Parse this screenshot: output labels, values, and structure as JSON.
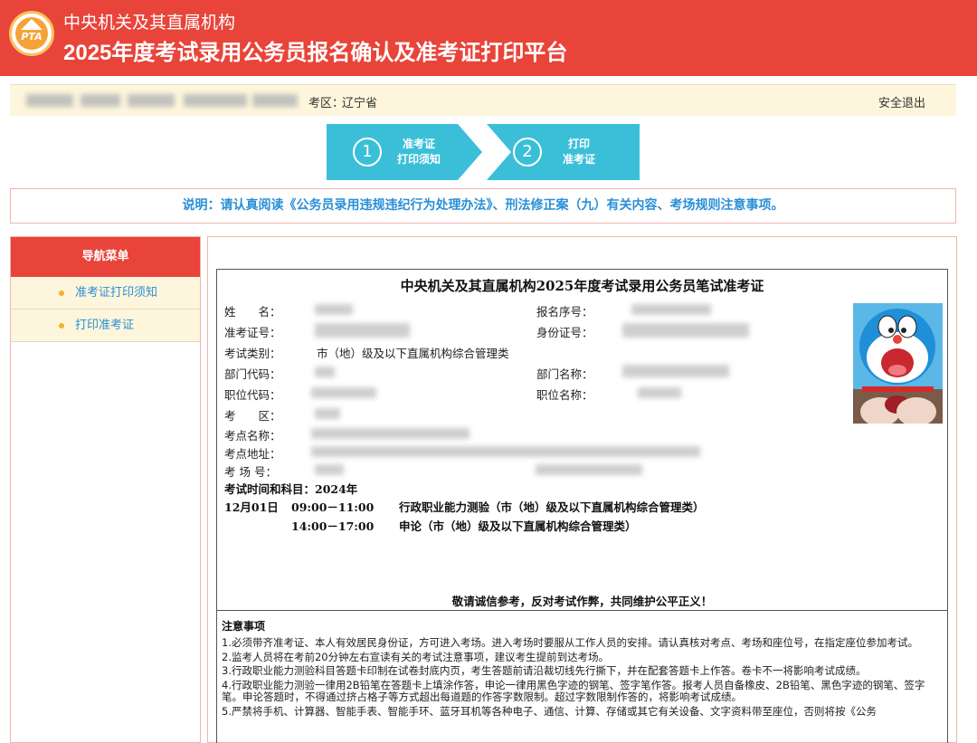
{
  "header": {
    "logo_text": "PTA",
    "subtitle": "中央机关及其直属机构",
    "title": "2025年度考试录用公务员报名确认及准考证打印平台"
  },
  "infobar": {
    "exam_area_label": "考区：",
    "exam_area_value": "辽宁省",
    "logout_label": "安全退出"
  },
  "steps": [
    {
      "number": "1",
      "label_line1": "准考证",
      "label_line2": "打印须知"
    },
    {
      "number": "2",
      "label_line1": "打印",
      "label_line2": "准考证"
    }
  ],
  "notice": "说明：请认真阅读《公务员录用违规违纪行为处理办法》、刑法修正案（九）有关内容、考场规则注意事项。",
  "sidebar": {
    "title": "导航菜单",
    "items": [
      {
        "label": "准考证打印须知"
      },
      {
        "label": "打印准考证"
      }
    ]
  },
  "ticket": {
    "title": "中央机关及其直属机构2025年度考试录用公务员笔试准考证",
    "fields": {
      "name_label": "姓　　名：",
      "reg_no_label": "报名序号：",
      "ticket_no_label": "准考证号：",
      "id_no_label": "身份证号：",
      "exam_type_label": "考试类别：",
      "exam_type_value": "市（地）级及以下直属机构综合管理类",
      "dept_code_label": "部门代码：",
      "dept_name_label": "部门名称：",
      "post_code_label": "职位代码：",
      "post_name_label": "职位名称：",
      "area_label": "考　　区：",
      "site_name_label": "考点名称：",
      "site_addr_label": "考点地址：",
      "room_label": "考 场 号："
    },
    "schedule_label": "考试时间和科目：2024年",
    "schedule": [
      {
        "date": "12月01日",
        "time": "09:00－11:00",
        "subject": "行政职业能力测验（市（地）级及以下直属机构综合管理类）"
      },
      {
        "date": "",
        "time": "14:00－17:00",
        "subject": "申论（市（地）级及以下直属机构综合管理类）"
      }
    ],
    "slogan": "敬请诚信参考，反对考试作弊，共同维护公平正义！"
  },
  "notes": {
    "title": "注意事项",
    "items": [
      "1.必须带齐准考证、本人有效居民身份证，方可进入考场。进入考场时要服从工作人员的安排。请认真核对考点、考场和座位号，在指定座位参加考试。",
      "2.监考人员将在考前20分钟左右宣读有关的考试注意事项，建议考生提前到达考场。",
      "3.行政职业能力测验科目答题卡印制在试卷封底内页，考生答题前请沿裁切线先行撕下，并在配套答题卡上作答。卷卡不一将影响考试成绩。",
      "4.行政职业能力测验一律用2B铅笔在答题卡上填涂作答，申论一律用黑色字迹的钢笔、签字笔作答。报考人员自备橡皮、2B铅笔、黑色字迹的钢笔、签字笔。申论答题时，不得通过挤占格子等方式超出每道题的作答字数限制。超过字数限制作答的，将影响考试成绩。",
      "5.严禁将手机、计算器、智能手表、智能手环、蓝牙耳机等各种电子、通信、计算、存储或其它有关设备、文字资料带至座位，否则将按《公务"
    ]
  },
  "colors": {
    "header_red": "#e8443a",
    "step_cyan": "#3bbfd9",
    "link_blue": "#2a8fd6",
    "infobar_bg": "#fdf6dc"
  }
}
